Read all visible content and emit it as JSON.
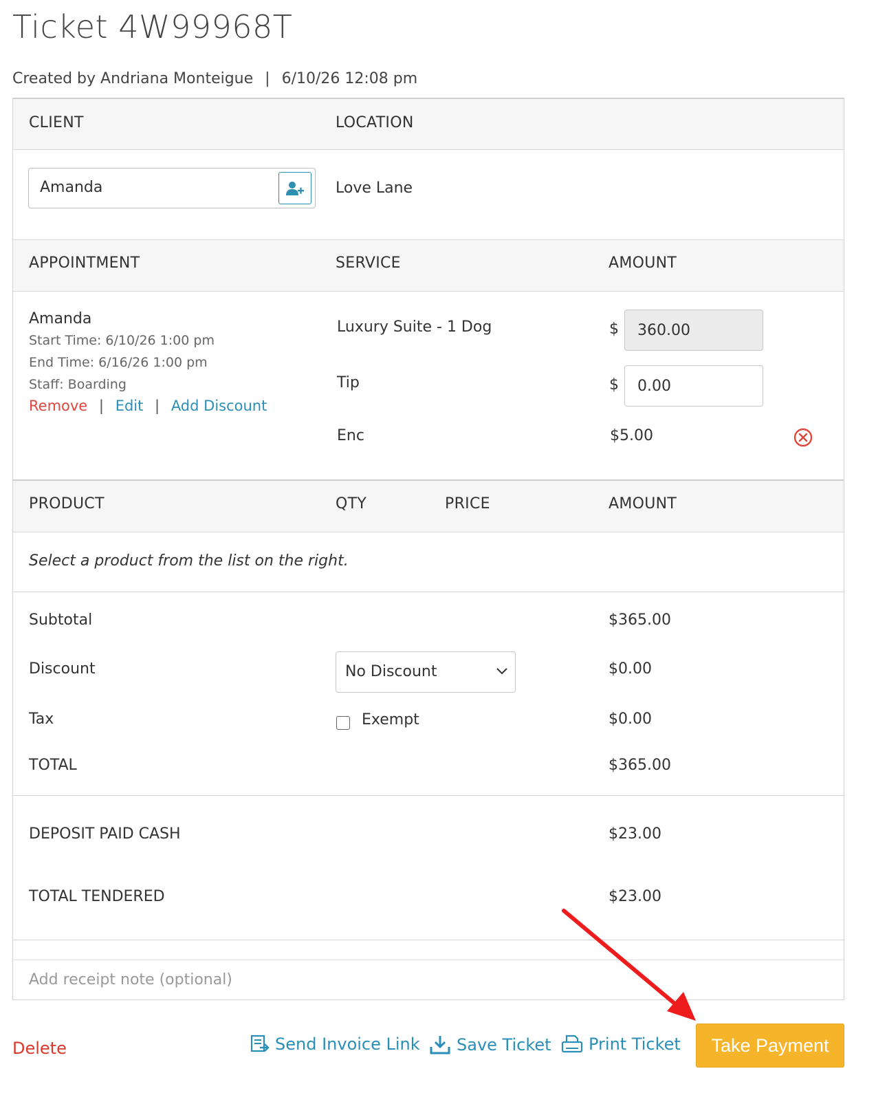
{
  "ticket": {
    "title": "Ticket 4W99968T",
    "created_prefix": "Created by",
    "created_by": "Andriana Monteigue",
    "separator": "|",
    "created_at": "6/10/26 12:08 pm"
  },
  "client_section": {
    "client_header": "CLIENT",
    "location_header": "LOCATION",
    "client_value": "Amanda",
    "location_value": "Love Lane",
    "add_client_icon": "add-user-icon"
  },
  "appointment_section": {
    "headers": {
      "appointment": "APPOINTMENT",
      "service": "SERVICE",
      "amount": "AMOUNT"
    },
    "client_name": "Amanda",
    "start_time": "Start Time: 6/10/26 1:00 pm",
    "end_time": "End Time: 6/16/26 1:00 pm",
    "staff": "Staff: Boarding",
    "links": {
      "remove": "Remove",
      "edit": "Edit",
      "add_discount": "Add Discount",
      "separator": "|"
    },
    "service": {
      "label": "Luxury Suite - 1 Dog",
      "currency": "$",
      "amount": "360.00"
    },
    "tip": {
      "label": "Tip",
      "currency": "$",
      "amount": "0.00"
    },
    "extra": {
      "label": "Enc",
      "amount": "$5.00",
      "remove_icon": "close-circle-icon"
    }
  },
  "product_section": {
    "headers": {
      "product": "PRODUCT",
      "qty": "QTY",
      "price": "PRICE",
      "amount": "AMOUNT"
    },
    "empty_message": "Select a product from the list on the right."
  },
  "totals": {
    "subtotal": {
      "label": "Subtotal",
      "value": "$365.00"
    },
    "discount": {
      "label": "Discount",
      "selected": "No Discount",
      "value": "$0.00"
    },
    "tax": {
      "label": "Tax",
      "exempt_label": "Exempt",
      "exempt_checked": false,
      "value": "$0.00"
    },
    "total": {
      "label": "TOTAL",
      "value": "$365.00"
    }
  },
  "payments": {
    "deposit": {
      "label": "DEPOSIT PAID CASH",
      "value": "$23.00"
    },
    "tendered": {
      "label": "TOTAL TENDERED",
      "value": "$23.00"
    }
  },
  "receipt_note": {
    "placeholder": "Add receipt note (optional)"
  },
  "footer": {
    "delete": "Delete",
    "send_invoice": "Send Invoice Link",
    "save_ticket": "Save Ticket",
    "print_ticket": "Print Ticket",
    "take_payment": "Take Payment"
  },
  "colors": {
    "accent_blue": "#2a8fb8",
    "danger_red": "#e0463b",
    "pay_button": "#f5b42a",
    "annotation_arrow": "#ee1c1c"
  }
}
